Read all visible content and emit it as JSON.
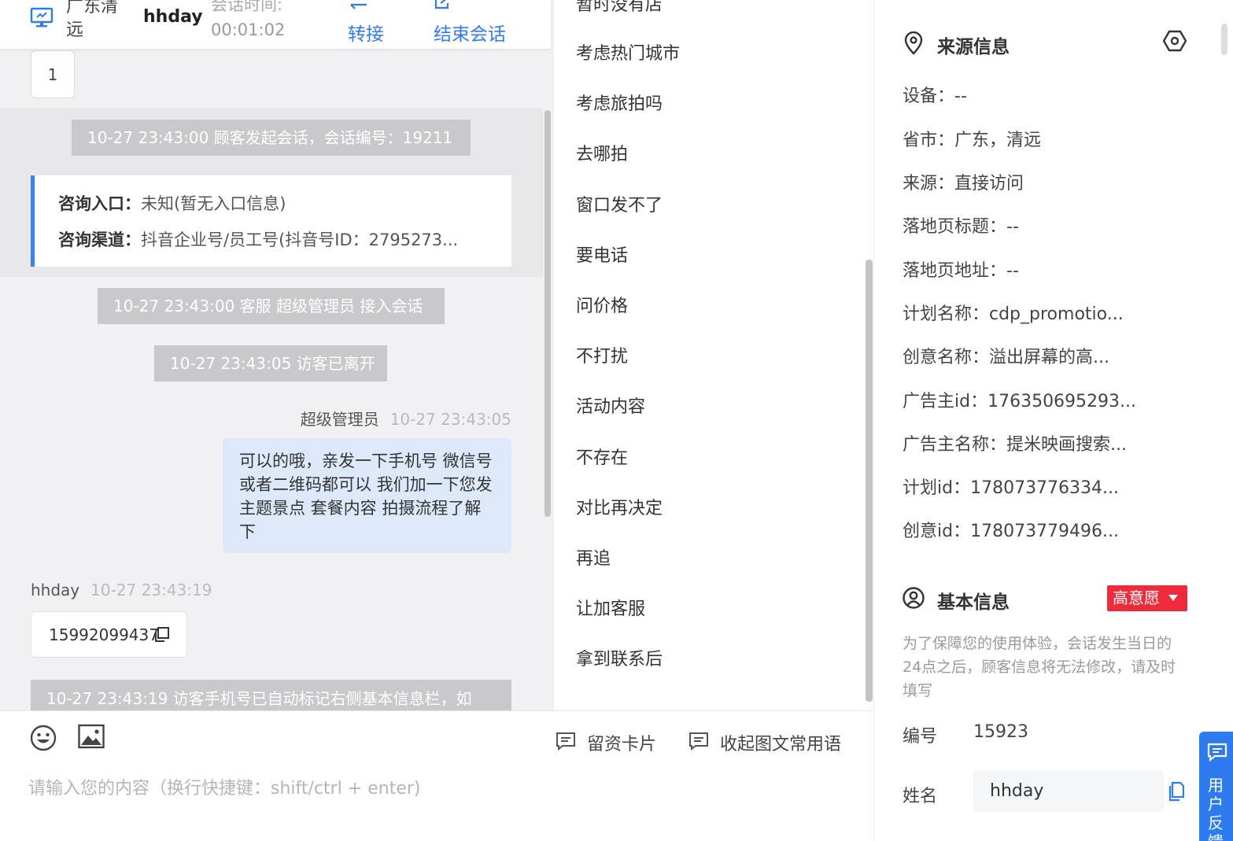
{
  "header": {
    "region_line1": "广东清",
    "region_line2": "远",
    "visitor_name": "hhday",
    "session_time_label": "会话时间:",
    "session_time": "00:01:02",
    "transfer_label": "转接",
    "end_label": "结束会话"
  },
  "chat": {
    "page_number": "1",
    "system_1": "10-27 23:43:00 顾客发起会话，会话编号：19211",
    "entry_label": "咨询入口：",
    "entry_value": "未知(暂无入口信息)",
    "channel_label": "咨询渠道：",
    "channel_value": "抖音企业号/员工号(抖音号ID：2795273...",
    "system_2": "10-27 23:43:00 客服 超级管理员 接入会话",
    "system_3": "10-27 23:43:05 访客已离开",
    "agent_name": "超级管理员",
    "agent_time": "10-27 23:43:05",
    "agent_message": "可以的哦，亲发一下手机号 微信号或者二维码都可以 我们加一下您发主题景点 套餐内容 拍摄流程了解下",
    "visitor_name": "hhday",
    "visitor_time": "10-27 23:43:19",
    "visitor_phone": "15992099437",
    "system_4": "10-27 23:43:19 访客手机号已自动标记右侧基本信息栏，如"
  },
  "quick_replies": [
    "暂时没有店",
    "考虑热门城市",
    "考虑旅拍吗",
    "去哪拍",
    "窗口发不了",
    "要电话",
    "问价格",
    "不打扰",
    "活动内容",
    "不存在",
    "对比再决定",
    "再追",
    "让加客服",
    "拿到联系后"
  ],
  "input": {
    "card_label": "留资卡片",
    "collapse_label": "收起图文常用语",
    "placeholder": "请输入您的内容（换行快捷键：shift/ctrl + enter)"
  },
  "info": {
    "source_title": "来源信息",
    "rows": [
      "设备：--",
      "省市：广东，清远",
      "来源：直接访问",
      "落地页标题：--",
      "落地页地址：--",
      "计划名称：cdp_promotio...",
      "创意名称：溢出屏幕的高...",
      "广告主id：176350695293...",
      "广告主名称：提米映画搜索...",
      "计划id：178073776334...",
      "创意id：178073779496..."
    ],
    "basic_title": "基本信息",
    "intent_badge": "高意愿",
    "notice": "为了保障您的使用体验，会话发生当日的24点之后，顾客信息将无法修改，请及时填写",
    "id_label": "编号",
    "id_value": "15923",
    "name_label": "姓名",
    "name_value": "hhday"
  },
  "feedback": {
    "label": "用户反馈"
  },
  "colors": {
    "accent": "#2e7bf0",
    "badge_red": "#ee2b3b",
    "agent_bubble": "#dde9fb",
    "system_msg": "#c9c9cc"
  }
}
